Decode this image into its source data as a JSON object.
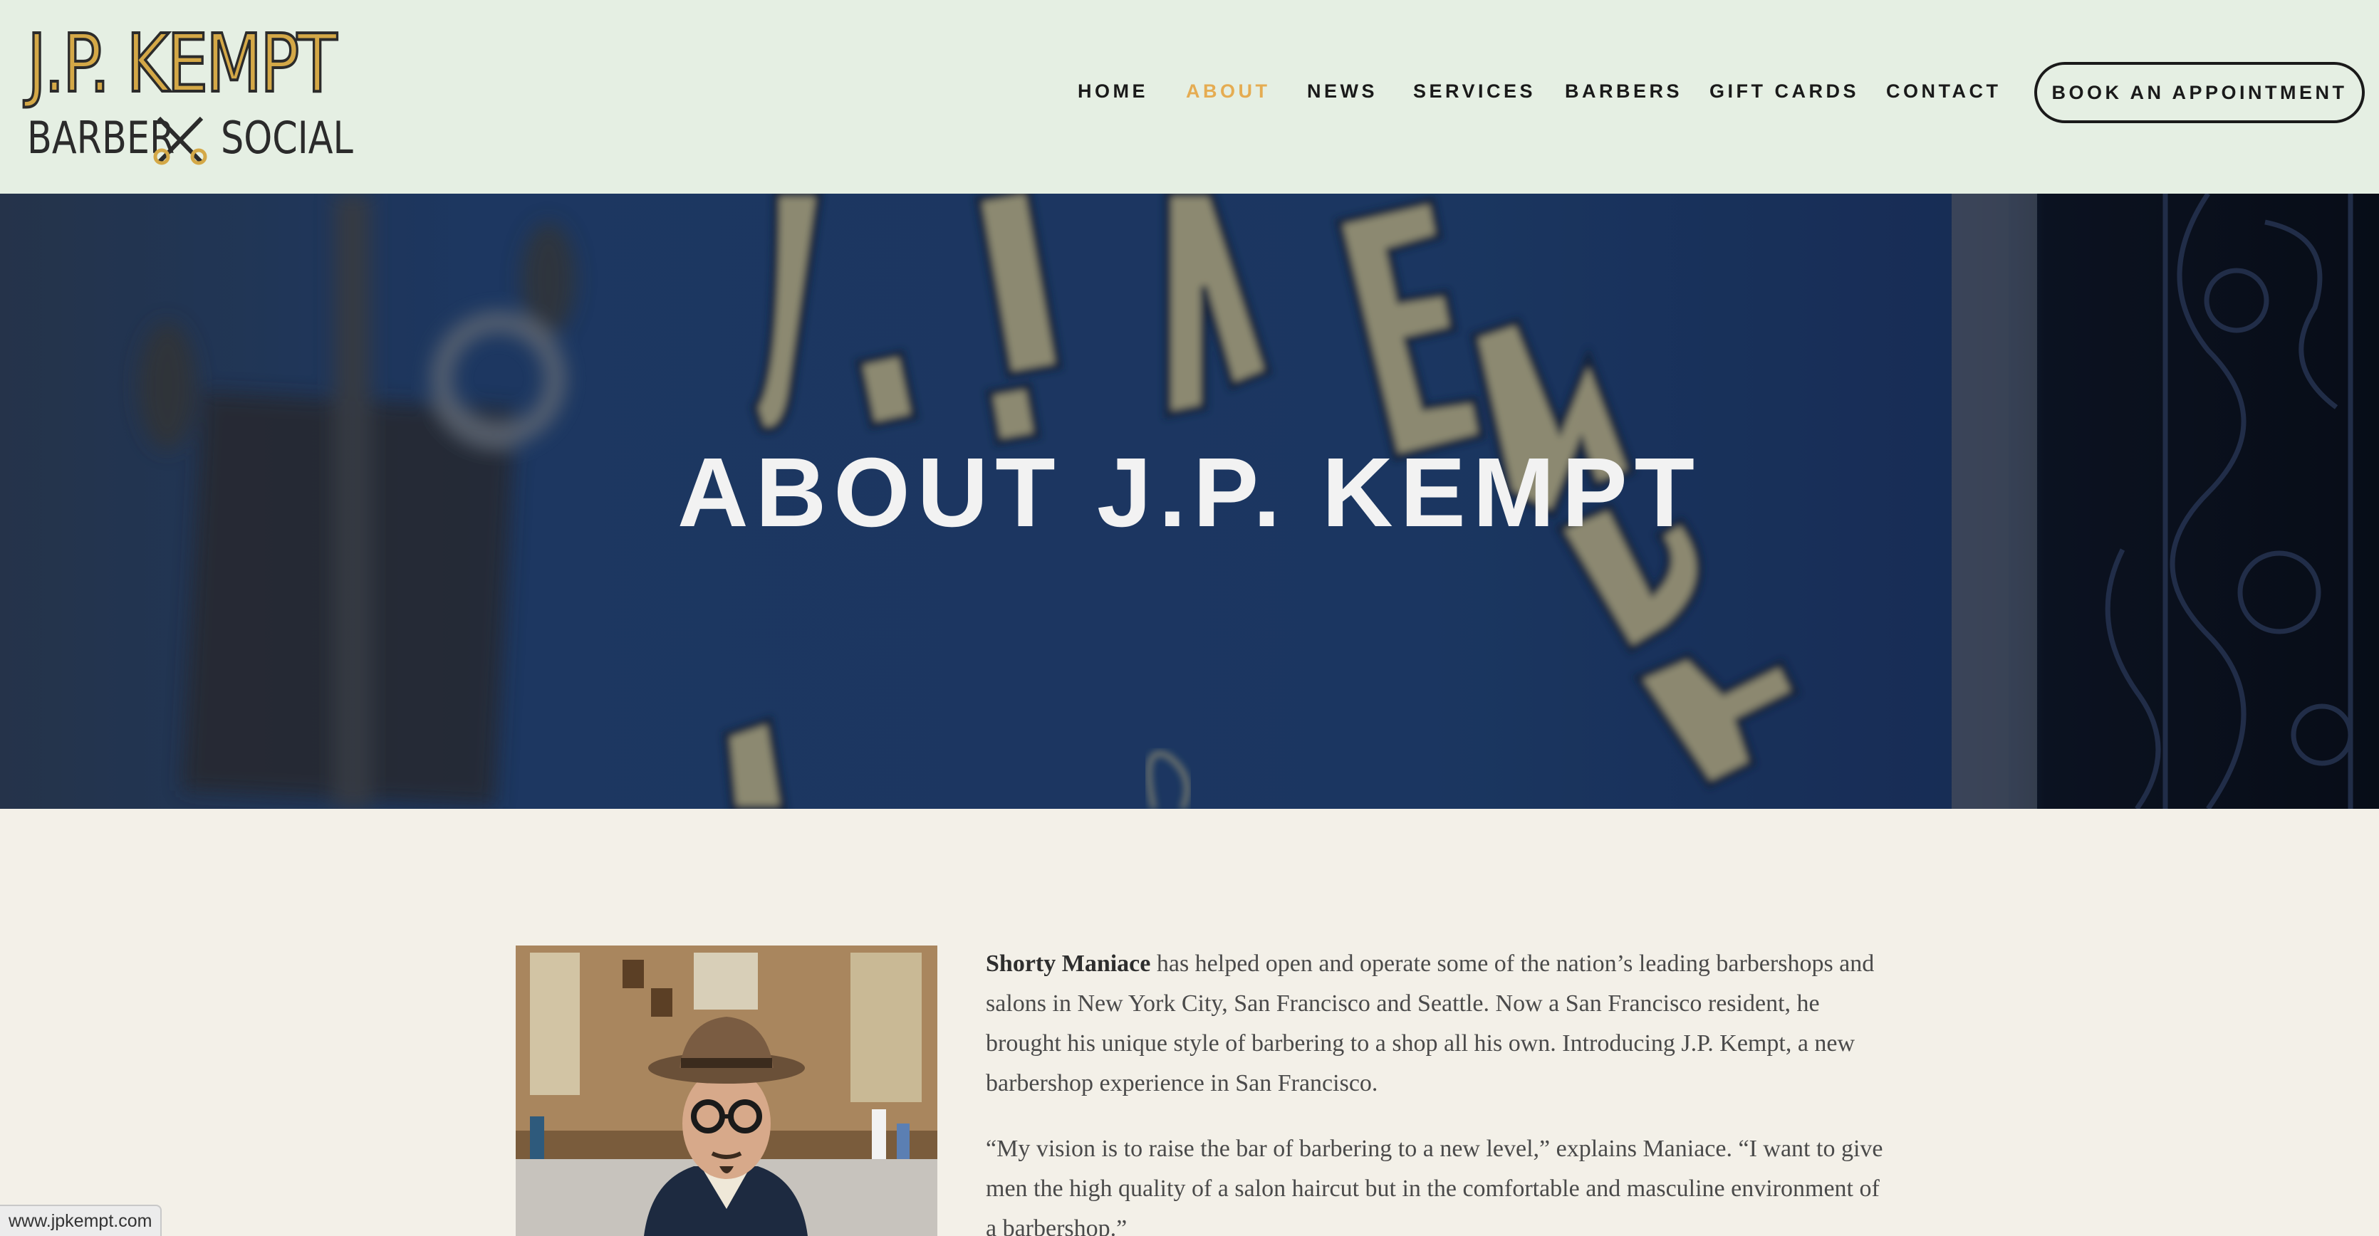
{
  "logo": {
    "top": "J.P. KEMPT",
    "bottom_left": "BARBER",
    "bottom_right": "SOCIAL"
  },
  "nav": {
    "items": [
      {
        "label": "HOME",
        "active": false
      },
      {
        "label": "ABOUT",
        "active": true
      },
      {
        "label": "NEWS",
        "active": false
      },
      {
        "label": "SERVICES",
        "active": false
      },
      {
        "label": "BARBERS",
        "active": false
      },
      {
        "label": "GIFT CARDS",
        "active": false
      },
      {
        "label": "CONTACT",
        "active": false
      }
    ],
    "cta": "BOOK AN APPOINTMENT"
  },
  "hero": {
    "title": "ABOUT J.P. KEMPT"
  },
  "content": {
    "intro_name": "Shorty Maniace",
    "intro_rest": " has helped open and operate some of the nation’s leading barbershops and salons in New York City, San Francisco and Seattle. Now a San Francisco resident, he brought his unique style of barbering to a shop all his own. Introducing J.P. Kempt, a new barbershop experience in San Francisco.",
    "quote": "“My vision is to raise the bar of barbering to a new level,” explains Maniace. “I want to give men the high quality of a salon haircut but in the comfortable and masculine environment of a barbershop.”"
  },
  "status_bar": {
    "url": "www.jpkempt.com"
  },
  "colors": {
    "header_bg": "#e5efe3",
    "accent": "#e5ac52",
    "page_bg": "#f3f0e8",
    "hero_blue": "#1d355f"
  }
}
